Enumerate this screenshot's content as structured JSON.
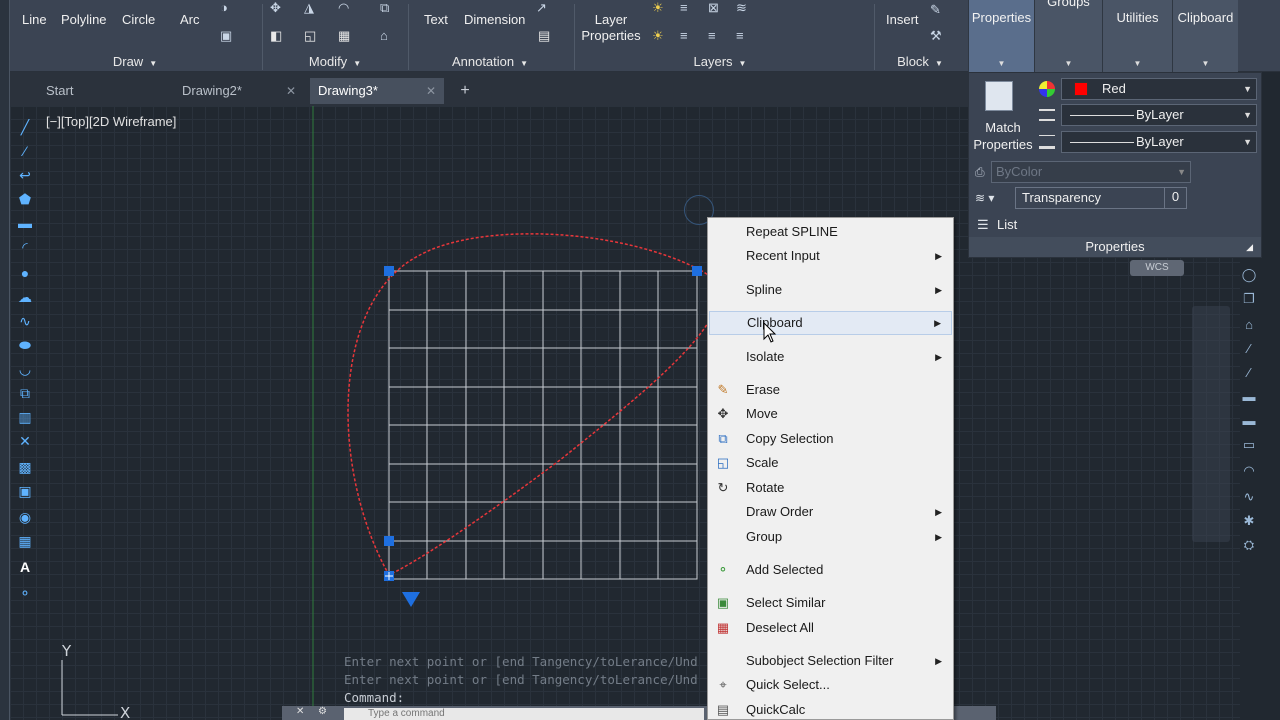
{
  "ribbon": {
    "draw_tools": [
      "Line",
      "Polyline",
      "Circle",
      "Arc"
    ],
    "panels": {
      "draw": "Draw",
      "modify": "Modify",
      "annotation": "Annotation",
      "layers": "Layers",
      "block": "Block"
    },
    "annotation_tools": [
      "Text",
      "Dimension"
    ],
    "layer_properties": "Layer Properties",
    "insert": "Insert",
    "tabs": [
      "Properties",
      "Groups",
      "Utilities",
      "Clipboard"
    ]
  },
  "file_tabs": [
    {
      "label": "Start",
      "active": false
    },
    {
      "label": "Drawing2*",
      "active": false
    },
    {
      "label": "Drawing3*",
      "active": true
    }
  ],
  "viewport": {
    "label": "[−][Top][2D Wireframe]"
  },
  "properties_panel": {
    "match_properties": "Match Properties",
    "color": "Red",
    "color_hex": "#ff0000",
    "linetype": "ByLayer",
    "lineweight": "ByLayer",
    "plot_style": "ByColor",
    "transparency_label": "Transparency",
    "transparency_value": "0",
    "list": "List",
    "title": "Properties"
  },
  "wcs_label": "WCS",
  "command_history": [
    "Enter next point or [end Tangency/toLerance/Und",
    "Enter next point or [end Tangency/toLerance/Und",
    "Command:"
  ],
  "command_placeholder": "Type a command",
  "context_menu": {
    "items": [
      {
        "label": "Repeat SPLINE",
        "submenu": false,
        "icon": ""
      },
      {
        "label": "Recent Input",
        "submenu": true,
        "icon": ""
      },
      {
        "label": "Spline",
        "submenu": true,
        "icon": ""
      },
      {
        "label": "Clipboard",
        "submenu": true,
        "icon": "",
        "hover": true
      },
      {
        "label": "Isolate",
        "submenu": true,
        "icon": ""
      },
      {
        "label": "Erase",
        "submenu": false,
        "icon": "eraser-icon"
      },
      {
        "label": "Move",
        "submenu": false,
        "icon": "move-icon"
      },
      {
        "label": "Copy Selection",
        "submenu": false,
        "icon": "copy-icon"
      },
      {
        "label": "Scale",
        "submenu": false,
        "icon": "scale-icon"
      },
      {
        "label": "Rotate",
        "submenu": false,
        "icon": "rotate-icon"
      },
      {
        "label": "Draw Order",
        "submenu": true,
        "icon": ""
      },
      {
        "label": "Group",
        "submenu": true,
        "icon": ""
      },
      {
        "label": "Add Selected",
        "submenu": false,
        "icon": "add-selected-icon"
      },
      {
        "label": "Select Similar",
        "submenu": false,
        "icon": "select-similar-icon"
      },
      {
        "label": "Deselect All",
        "submenu": false,
        "icon": "deselect-icon"
      },
      {
        "label": "Subobject Selection Filter",
        "submenu": true,
        "icon": ""
      },
      {
        "label": "Quick Select...",
        "submenu": false,
        "icon": "quick-select-icon"
      },
      {
        "label": "QuickCalc",
        "submenu": false,
        "icon": "calculator-icon"
      }
    ]
  },
  "colors": {
    "accent": "#5fb3ff",
    "spline": "#e8363a",
    "grip": "#1e6fe0",
    "canvas": "#212830"
  }
}
